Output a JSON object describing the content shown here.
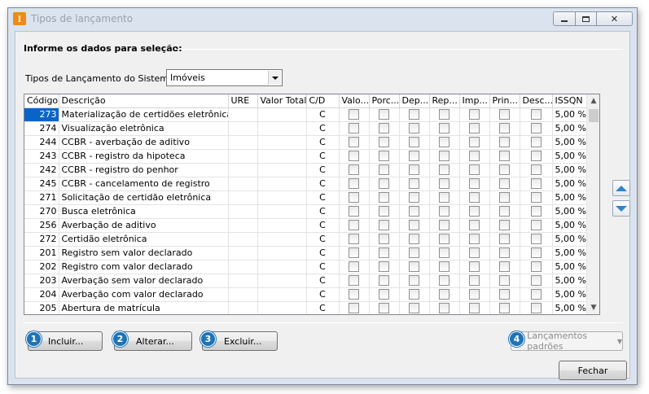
{
  "window": {
    "title": "Tipos de lançamento",
    "app_icon_letter": "I",
    "minimize_icon": "minimize-icon",
    "maximize_icon": "maximize-icon",
    "close_icon": "close-icon"
  },
  "section": {
    "title": "Informe os dados para seleção:"
  },
  "filter": {
    "label": "Tipos de Lançamento do Sistema:",
    "selected": "Imóveis"
  },
  "grid": {
    "columns": [
      "Código",
      "Descrição",
      "URE",
      "Valor Total",
      "C/D",
      "Valo...",
      "Porc...",
      "Dep...",
      "Rep...",
      "Imp...",
      "Prin...",
      "Desc...",
      "ISSQN"
    ],
    "rows": [
      {
        "code": "273",
        "desc": "Materialização de certidões eletrônicas",
        "cd": "C",
        "issqn": "5,00 %"
      },
      {
        "code": "274",
        "desc": "Visualização eletrônica",
        "cd": "C",
        "issqn": "5,00 %"
      },
      {
        "code": "244",
        "desc": "CCBR - averbação de aditivo",
        "cd": "C",
        "issqn": "5,00 %"
      },
      {
        "code": "243",
        "desc": "CCBR - registro da hipoteca",
        "cd": "C",
        "issqn": "5,00 %"
      },
      {
        "code": "242",
        "desc": "CCBR - registro do penhor",
        "cd": "C",
        "issqn": "5,00 %"
      },
      {
        "code": "245",
        "desc": "CCBR - cancelamento de registro",
        "cd": "C",
        "issqn": "5,00 %"
      },
      {
        "code": "271",
        "desc": "Solicitação de certidão eletrônica",
        "cd": "C",
        "issqn": "5,00 %"
      },
      {
        "code": "270",
        "desc": "Busca eletrônica",
        "cd": "C",
        "issqn": "5,00 %"
      },
      {
        "code": "256",
        "desc": "Averbação de aditivo",
        "cd": "C",
        "issqn": "5,00 %"
      },
      {
        "code": "272",
        "desc": "Certidão eletrônica",
        "cd": "C",
        "issqn": "5,00 %"
      },
      {
        "code": "201",
        "desc": "Registro sem valor declarado",
        "cd": "C",
        "issqn": "5,00 %"
      },
      {
        "code": "202",
        "desc": "Registro com valor declarado",
        "cd": "C",
        "issqn": "5,00 %"
      },
      {
        "code": "203",
        "desc": "Averbação sem valor declarado",
        "cd": "C",
        "issqn": "5,00 %"
      },
      {
        "code": "204",
        "desc": "Averbação com valor declarado",
        "cd": "C",
        "issqn": "5,00 %"
      },
      {
        "code": "205",
        "desc": "Abertura de matrícula",
        "cd": "C",
        "issqn": "5,00 %"
      }
    ]
  },
  "buttons": {
    "incluir": {
      "badge": "1",
      "label": "Incluir..."
    },
    "alterar": {
      "badge": "2",
      "label": "Alterar..."
    },
    "excluir": {
      "badge": "3",
      "label": "Excluir..."
    },
    "padroes": {
      "badge": "4",
      "label": "Lançamentos padrões"
    },
    "fechar": {
      "label": "Fechar"
    }
  }
}
